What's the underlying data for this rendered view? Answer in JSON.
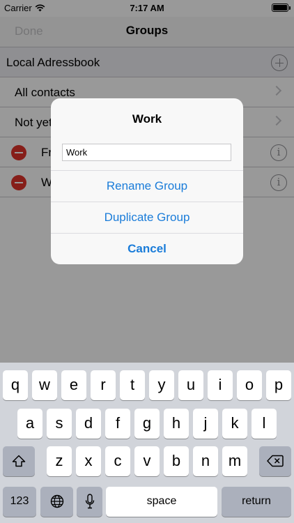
{
  "status_bar": {
    "carrier": "Carrier",
    "time": "7:17 AM"
  },
  "nav": {
    "done_label": "Done",
    "title": "Groups"
  },
  "section": {
    "header": "Local Adressbook"
  },
  "rows": [
    {
      "label": "All contacts"
    },
    {
      "label": "Not yet"
    },
    {
      "label": "Fr"
    },
    {
      "label": "W"
    }
  ],
  "alert": {
    "title": "Work",
    "input_value": "Work",
    "rename_label": "Rename Group",
    "duplicate_label": "Duplicate Group",
    "cancel_label": "Cancel"
  },
  "keyboard": {
    "row1": [
      "q",
      "w",
      "e",
      "r",
      "t",
      "y",
      "u",
      "i",
      "o",
      "p"
    ],
    "row2": [
      "a",
      "s",
      "d",
      "f",
      "g",
      "h",
      "j",
      "k",
      "l"
    ],
    "row3": [
      "z",
      "x",
      "c",
      "v",
      "b",
      "n",
      "m"
    ],
    "numbers_label": "123",
    "space_label": "space",
    "return_label": "return"
  },
  "colors": {
    "accent": "#1a7cd9",
    "delete": "#e0322a"
  }
}
